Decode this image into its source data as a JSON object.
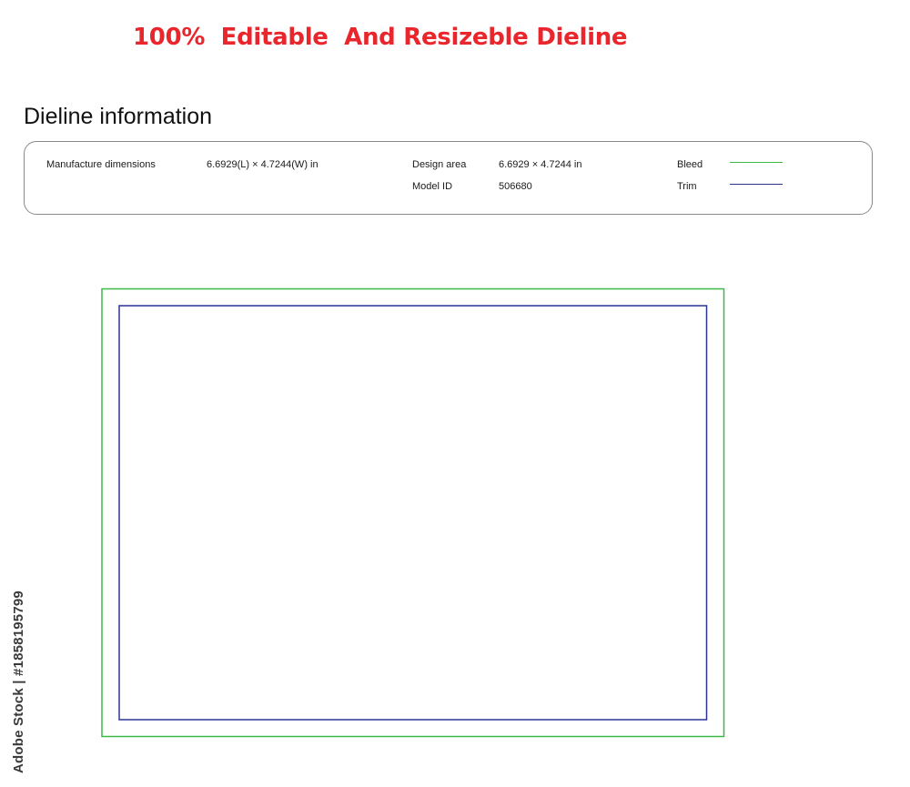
{
  "headline": "100%  Editable  And Resizeble Dieline",
  "section_title": "Dieline information",
  "info": {
    "manufacture_label": "Manufacture dimensions",
    "manufacture_value": "6.6929(L) × 4.7244(W) in",
    "design_area_label": "Design area",
    "design_area_value": "6.6929 × 4.7244 in",
    "model_id_label": "Model ID",
    "model_id_value": "506680"
  },
  "legend": {
    "bleed": {
      "label": "Bleed",
      "color": "#3cb94a"
    },
    "trim": {
      "label": "Trim",
      "color": "#2b3596"
    }
  },
  "watermark": "Adobe Stock | #1858195799",
  "colors": {
    "headline": "#e8262c",
    "bleed": "#3cb94a",
    "trim": "#2b3596"
  }
}
